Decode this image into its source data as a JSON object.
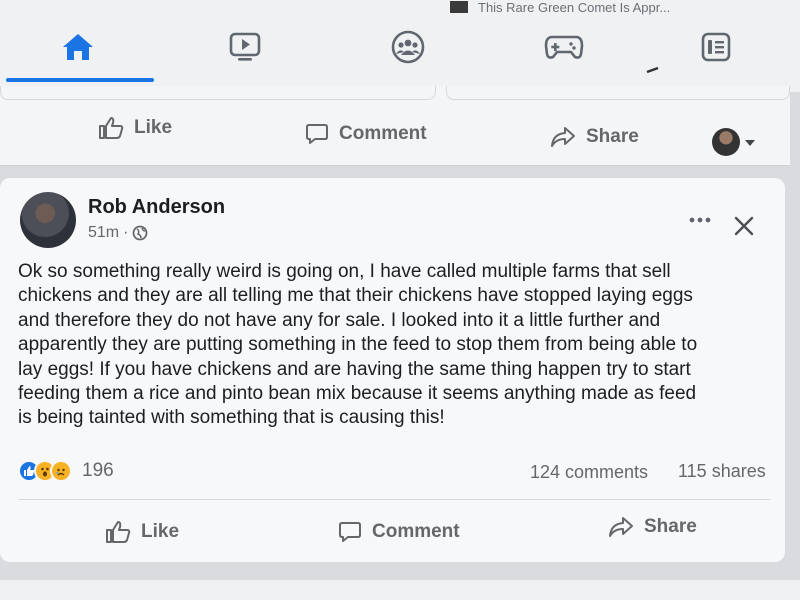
{
  "ad": {
    "text": "This Rare Green Comet Is Appr..."
  },
  "nav": {
    "tabs": [
      {
        "name": "home",
        "icon": "home-icon",
        "active": true
      },
      {
        "name": "watch",
        "icon": "video-icon",
        "active": false
      },
      {
        "name": "groups",
        "icon": "groups-icon",
        "active": false
      },
      {
        "name": "gaming",
        "icon": "gamepad-icon",
        "active": false
      },
      {
        "name": "menu",
        "icon": "feeds-icon",
        "active": false
      }
    ],
    "accent": "#1b74e4"
  },
  "prev_post": {
    "actions": {
      "like": "Like",
      "comment": "Comment",
      "share": "Share"
    }
  },
  "post": {
    "author": "Rob Anderson",
    "time": "51m",
    "separator": "·",
    "body_lines": [
      "Ok so something really weird is going on, I have called multiple farms that sell",
      "chickens and they are all telling me that their chickens have stopped laying eggs",
      "and therefore they do not have any for sale. I looked into it a little further and",
      "apparently they are putting something in the feed to stop them from being able to",
      "lay eggs! If you have chickens and are having the same thing happen try to start",
      "feeding them a rice and pinto bean mix because it seems anything made as feed",
      "is being tainted with something that is causing this!"
    ],
    "reaction_count": "196",
    "reactions": [
      "like",
      "wow",
      "sad"
    ],
    "comments": "124 comments",
    "shares": "115 shares",
    "actions": {
      "like": "Like",
      "comment": "Comment",
      "share": "Share"
    }
  }
}
